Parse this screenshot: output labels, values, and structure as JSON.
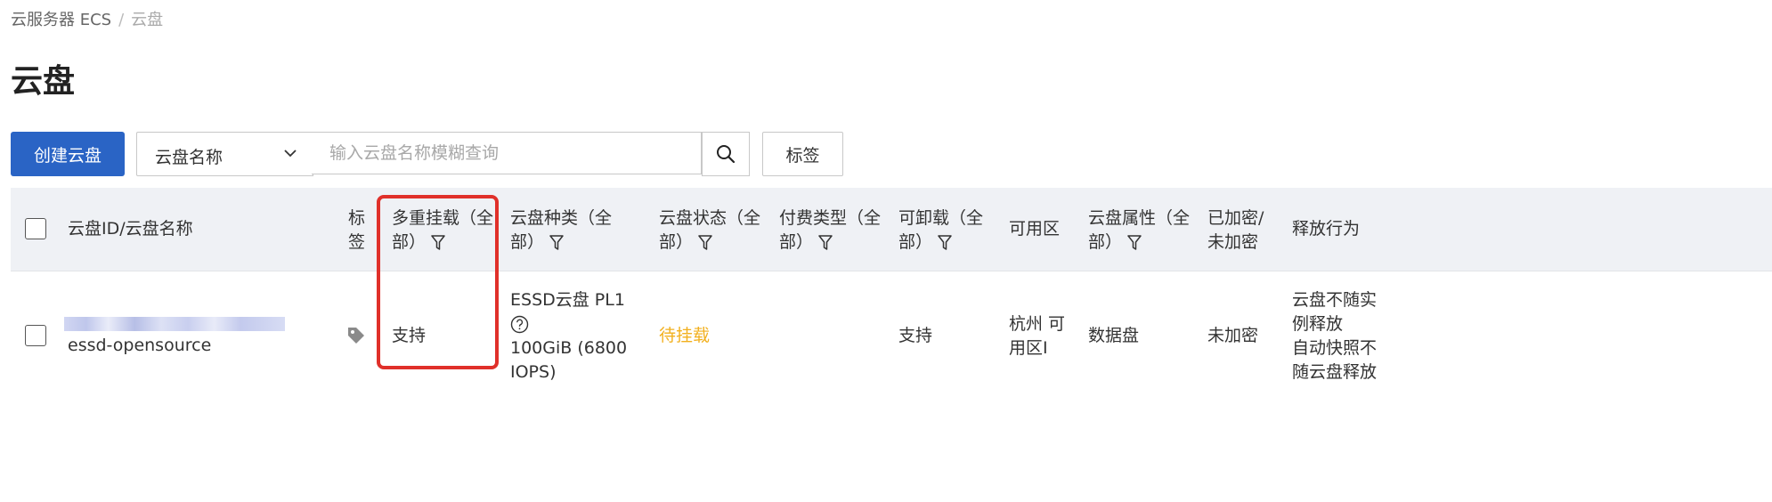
{
  "breadcrumb": {
    "parent": "云服务器 ECS",
    "separator": "/",
    "current": "云盘"
  },
  "page": {
    "title": "云盘"
  },
  "toolbar": {
    "create_label": "创建云盘",
    "select_value": "云盘名称",
    "search_placeholder": "输入云盘名称模糊查询",
    "tag_label": "标签"
  },
  "table": {
    "headers": {
      "name": "云盘ID/云盘名称",
      "tag_l1": "标",
      "tag_l2": "签",
      "multi_l1": "多重挂载（全",
      "multi_l2": "部）",
      "type_l1": "云盘种类（全",
      "type_l2": "部）",
      "status_l1": "云盘状态（全",
      "status_l2": "部）",
      "billing_l1": "付费类型（全",
      "billing_l2": "部）",
      "detach_l1": "可卸载（全",
      "detach_l2": "部）",
      "zone": "可用区",
      "attr_l1": "云盘属性（全",
      "attr_l2": "部）",
      "enc_l1": "已加密/",
      "enc_l2": "未加密",
      "release": "释放行为"
    },
    "rows": [
      {
        "name": "essd-opensource",
        "multi_attach": "支持",
        "type_l1": "ESSD云盘  PL1",
        "type_l2": "100GiB (6800",
        "type_l3": "IOPS)",
        "status": "待挂载",
        "detachable": "支持",
        "zone_l1": "杭州 可",
        "zone_l2": "用区I",
        "attribute": "数据盘",
        "encryption": "未加密",
        "release_l1": "云盘不随实",
        "release_l2": "例释放",
        "release_l3": "自动快照不",
        "release_l4": "随云盘释放"
      }
    ]
  },
  "colors": {
    "primary": "#2a64c5",
    "pending": "#f2b01e",
    "highlight": "#e0302a",
    "header_bg": "#eff1f5"
  }
}
